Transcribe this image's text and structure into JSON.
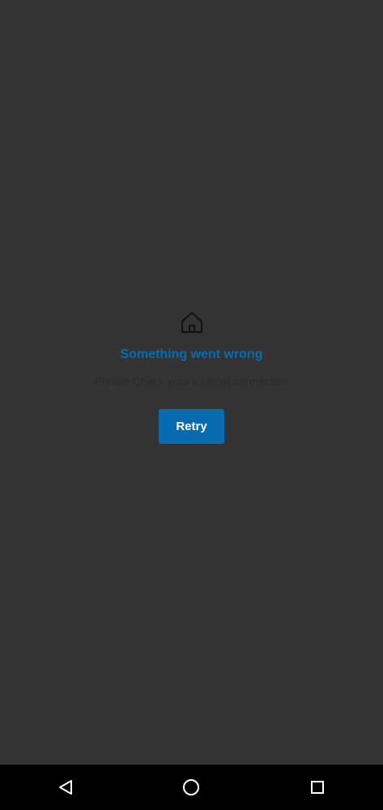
{
  "error": {
    "icon": "home-icon",
    "title": "Something went wrong",
    "message": "Please Check your internet connection",
    "retry_label": "Retry"
  },
  "colors": {
    "background": "#333333",
    "accent": "#0a6cb0",
    "nav_bar": "#000000",
    "nav_icons": "#ffffff"
  },
  "nav_bar": {
    "icons": [
      "back-icon",
      "home-circle-icon",
      "recents-icon"
    ]
  }
}
